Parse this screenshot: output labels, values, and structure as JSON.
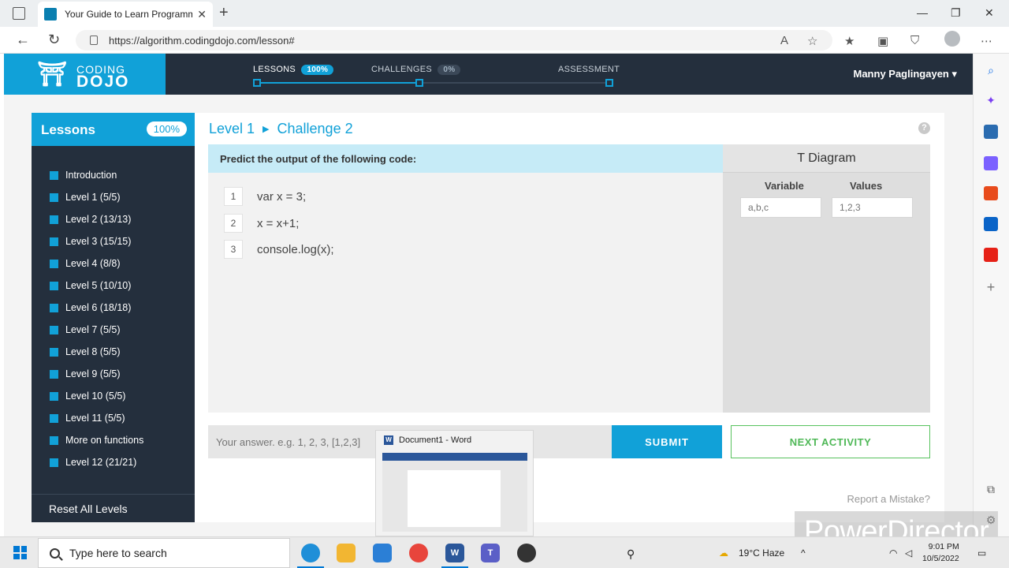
{
  "browser": {
    "tab_title": "Your Guide to Learn Programming",
    "tab_close": "✕",
    "new_tab": "+",
    "url": "https://algorithm.codingdojo.com/lesson#",
    "window_controls": {
      "minimize": "—",
      "restore": "❐",
      "close": "✕"
    },
    "nav": {
      "back": "←",
      "reload": "↻"
    }
  },
  "header": {
    "logo_line1": "CODING",
    "logo_line2": "DOJO",
    "progress": [
      {
        "label": "LESSONS",
        "pct": "100%",
        "fraction": 1.0
      },
      {
        "label": "CHALLENGES",
        "pct": "0%",
        "fraction": 0.0
      },
      {
        "label": "ASSESSMENT",
        "pct": ""
      }
    ],
    "user_name": "Manny Paglingayen ▾"
  },
  "sidebar": {
    "title": "Lessons",
    "pct": "100%",
    "items": [
      "Introduction",
      "Level 1 (5/5)",
      "Level 2 (13/13)",
      "Level 3 (15/15)",
      "Level 4 (8/8)",
      "Level 5 (10/10)",
      "Level 6 (18/18)",
      "Level 7 (5/5)",
      "Level 8 (5/5)",
      "Level 9 (5/5)",
      "Level 10 (5/5)",
      "Level 11 (5/5)",
      "More on functions",
      "Level 12 (21/21)"
    ],
    "reset_label": "Reset All Levels"
  },
  "main": {
    "crumb_level": "Level 1",
    "crumb_challenge": "Challenge 2",
    "help": "?",
    "prompt": "Predict the output of the following code:",
    "code": [
      {
        "num": "1",
        "text": "var x = 3;"
      },
      {
        "num": "2",
        "text": "x = x+1;"
      },
      {
        "num": "3",
        "text": "console.log(x);"
      }
    ],
    "t_diagram": {
      "title": "T Diagram",
      "col_variable": "Variable",
      "col_values": "Values",
      "variable_placeholder": "a,b,c",
      "values_placeholder": "1,2,3"
    },
    "answer_placeholder": "Your answer. e.g. 1, 2, 3, [1,2,3]",
    "submit_label": "SUBMIT",
    "next_label": "NEXT ACTIVITY",
    "report_label": "Report a Mistake?"
  },
  "word_popup": {
    "badge": "W",
    "title": "Document1 - Word"
  },
  "watermark": "PowerDirector",
  "taskbar": {
    "search_placeholder": "Type here to search",
    "weather": "19°C  Haze",
    "time": "9:01 PM",
    "date": "10/5/2022"
  }
}
